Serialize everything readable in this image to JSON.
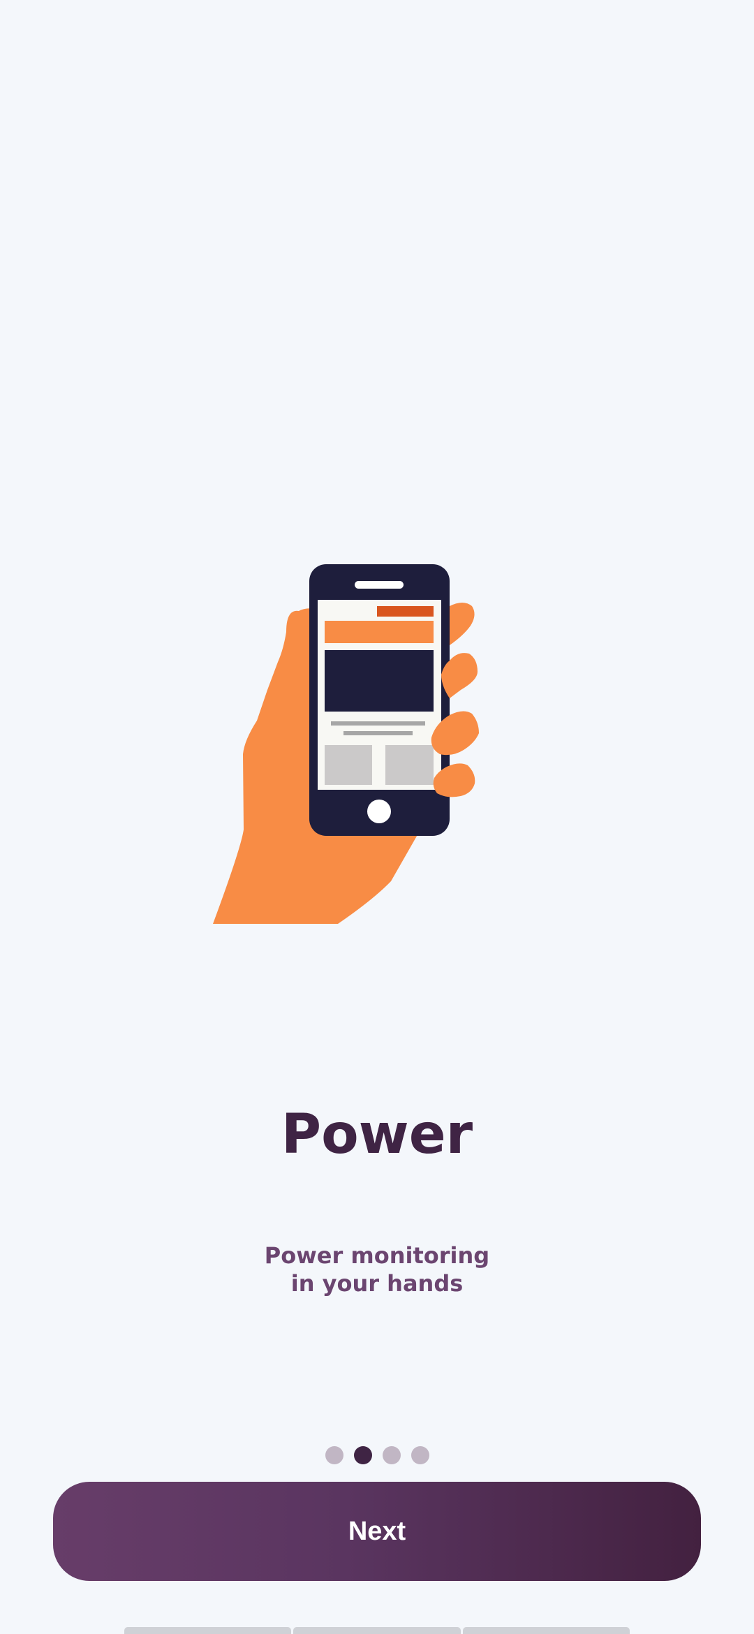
{
  "onboarding": {
    "title": "Power",
    "subtitle_lines": [
      "Power monitoring",
      "in your hands"
    ],
    "page_indicator": {
      "total": 4,
      "active_index": 1
    },
    "next_label": "Next",
    "illustration_icon": "hand-holding-phone-icon"
  },
  "colors": {
    "background": "#f4f7fb",
    "title": "#3f2444",
    "subtitle": "#6b4570",
    "hand": "#f88c45",
    "phone_body": "#1e1e3c",
    "button_gradient_start": "#673d69",
    "button_gradient_end": "#432140",
    "dot_inactive": "#c1b6c4",
    "dot_active": "#3f2444"
  }
}
